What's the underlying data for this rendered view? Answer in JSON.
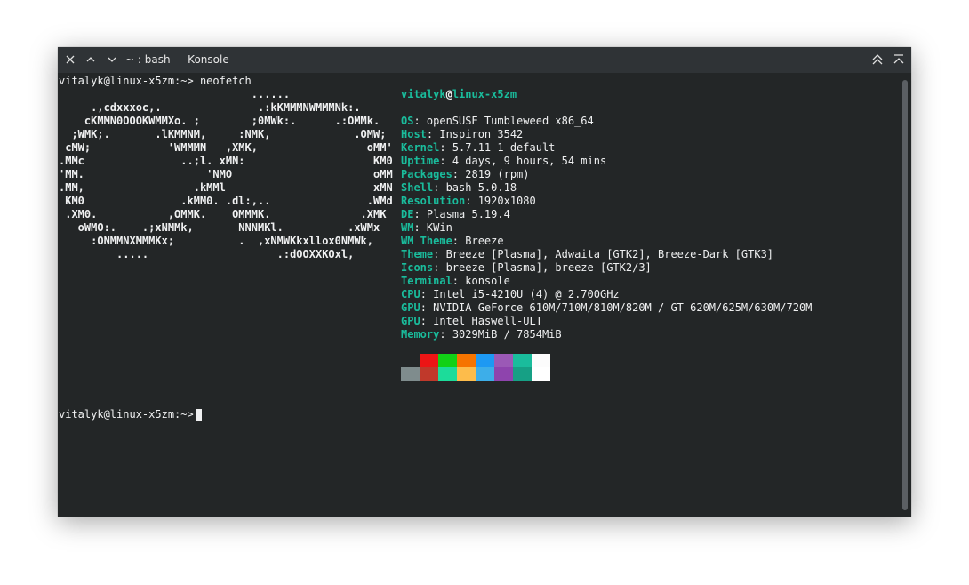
{
  "window": {
    "title": "~ : bash — Konsole"
  },
  "colors": {
    "accent": "#1abc9c",
    "background": "#232627",
    "titlebar": "#2f3336",
    "text": "#eff0f1"
  },
  "titlebar_icons": {
    "close": "close-icon",
    "minimize": "chevron-down-icon",
    "maximize": "chevron-up-icon",
    "keep_above": "double-chevron-up-icon",
    "shade": "shade-icon"
  },
  "terminal": {
    "prompt_line": "vitalyk@linux-x5zm:~> neofetch",
    "final_prompt": "vitalyk@linux-x5zm:~> ",
    "logo_lines": [
      "                              ......",
      "     .,cdxxxoc,.               .:kKMMMNWMMMNk:.",
      "    cKMMN0OOOKWMMXo. ;        ;0MWk:.      .:OMMk.",
      "  ;WMK;.       .lKMMNM,     :NMK,             .OMW;",
      " cMW;            'WMMMN   ,XMK,                 oMM'",
      ".MMc               ..;l. xMN:                    KM0",
      "'MM.                   'NMO                      oMM",
      ".MM,                 .kMMl                       xMN",
      " KM0               .kMM0. .dl:,..               .WMd",
      " .XM0.           ,OMMK.    OMMMK.              .XMK",
      "   oWMO:.    .;xNMMk,       NNNMKl.          .xWMx",
      "     :ONMMNXMMMKx;          .  ,xNMWKkxllox0NMWk,",
      "         .....                    .:dOOXXKOxl,"
    ],
    "user_host": {
      "user": "vitalyk",
      "at": "@",
      "host": "linux-x5zm"
    },
    "separator": "------------------",
    "info": [
      {
        "key": "OS",
        "value": "openSUSE Tumbleweed x86_64"
      },
      {
        "key": "Host",
        "value": "Inspiron 3542"
      },
      {
        "key": "Kernel",
        "value": "5.7.11-1-default"
      },
      {
        "key": "Uptime",
        "value": "4 days, 9 hours, 54 mins"
      },
      {
        "key": "Packages",
        "value": "2819 (rpm)"
      },
      {
        "key": "Shell",
        "value": "bash 5.0.18"
      },
      {
        "key": "Resolution",
        "value": "1920x1080"
      },
      {
        "key": "DE",
        "value": "Plasma 5.19.4"
      },
      {
        "key": "WM",
        "value": "KWin"
      },
      {
        "key": "WM Theme",
        "value": "Breeze"
      },
      {
        "key": "Theme",
        "value": "Breeze [Plasma], Adwaita [GTK2], Breeze-Dark [GTK3]"
      },
      {
        "key": "Icons",
        "value": "breeze [Plasma], breeze [GTK2/3]"
      },
      {
        "key": "Terminal",
        "value": "konsole"
      },
      {
        "key": "CPU",
        "value": "Intel i5-4210U (4) @ 2.700GHz"
      },
      {
        "key": "GPU",
        "value": "NVIDIA GeForce 610M/710M/810M/820M / GT 620M/625M/630M/720M"
      },
      {
        "key": "GPU",
        "value": "Intel Haswell-ULT"
      },
      {
        "key": "Memory",
        "value": "3029MiB / 7854MiB"
      }
    ],
    "palette_top": [
      "#232627",
      "#ed1515",
      "#11d116",
      "#f67400",
      "#1d99f3",
      "#9b59b6",
      "#1abc9c",
      "#fcfcfc"
    ],
    "palette_bottom": [
      "#7f8c8d",
      "#c0392b",
      "#1cdc9a",
      "#fdbc4b",
      "#3daee9",
      "#8e44ad",
      "#16a085",
      "#ffffff"
    ]
  }
}
